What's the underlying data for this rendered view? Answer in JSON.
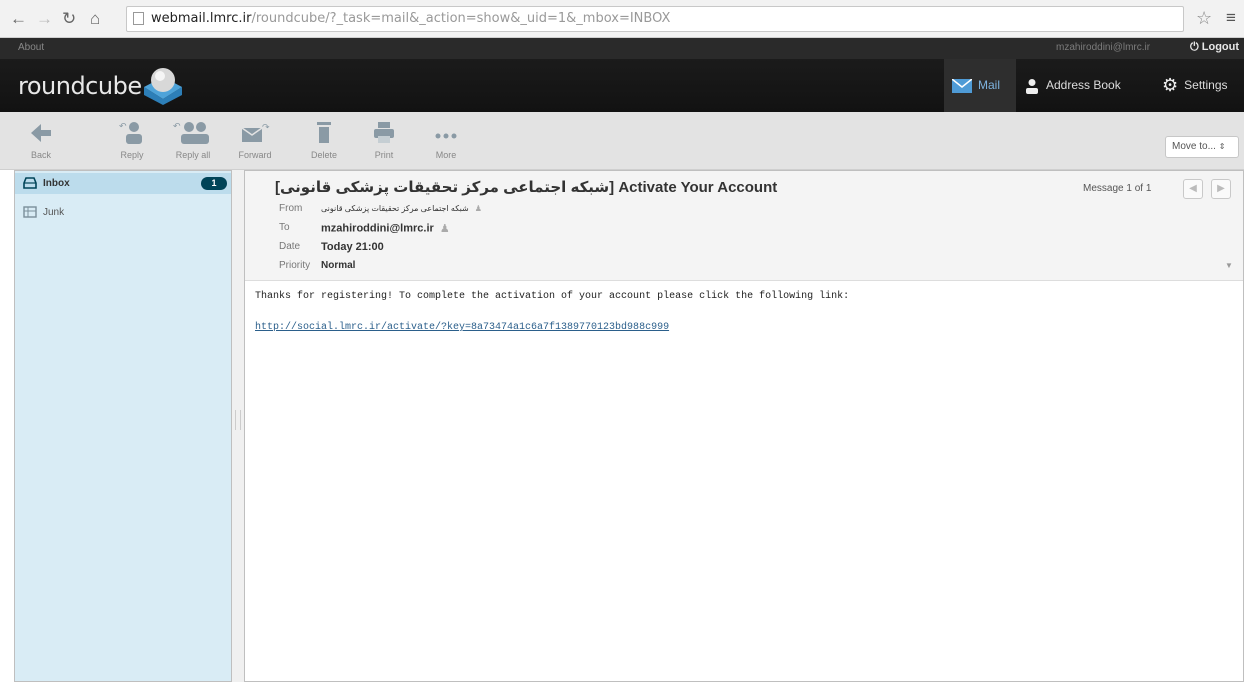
{
  "browser": {
    "url_host": "webmail.lmrc.ir",
    "url_rest": "/roundcube/?_task=mail&_action=show&_uid=1&_mbox=INBOX"
  },
  "topline": {
    "about": "About",
    "user": "mzahiroddini@lmrc.ir",
    "logout": "Logout"
  },
  "header": {
    "logo": "roundcube",
    "tabs": {
      "mail": "Mail",
      "address_book": "Address Book",
      "settings": "Settings"
    }
  },
  "toolbar": {
    "back": "Back",
    "reply": "Reply",
    "reply_all": "Reply all",
    "forward": "Forward",
    "delete": "Delete",
    "print": "Print",
    "more": "More",
    "move_to": "Move to..."
  },
  "folders": [
    {
      "name": "Inbox",
      "unread": "1"
    },
    {
      "name": "Junk"
    }
  ],
  "message": {
    "subject": "[شبکه اجتماعی مرکز تحقیقات پزشکی قانونی] Activate Your Account",
    "count": "Message 1 of 1",
    "labels": {
      "from": "From",
      "to": "To",
      "date": "Date",
      "priority": "Priority"
    },
    "from": "شبکه اجتماعی مرکز تحقیقات پزشکی قانونی",
    "to": "mzahiroddini@lmrc.ir",
    "date": "Today 21:00",
    "priority": "Normal",
    "body": "Thanks for registering! To complete the activation of your account please click the following link:",
    "link": "http://social.lmrc.ir/activate/?key=8a73474a1c6a7f1389770123bd988c999"
  },
  "colors": {
    "accent": "#7db3df",
    "folder_bg": "#d9ecf5",
    "badge": "#004458"
  }
}
